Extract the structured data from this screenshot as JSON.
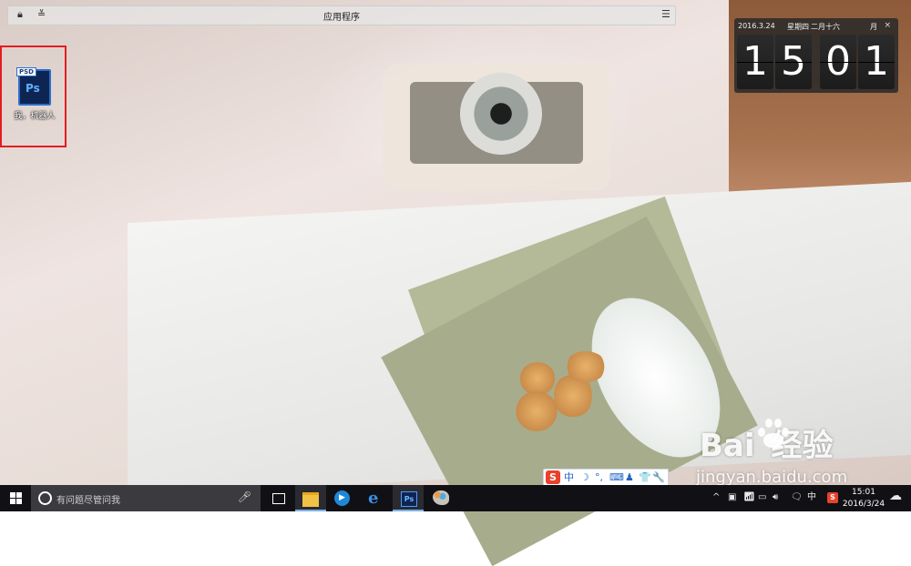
{
  "app_bar": {
    "title": "应用程序",
    "lock_icon": "lock-icon",
    "collapse_icon": "double-chevron-down-icon",
    "menu_icon": "menu-icon"
  },
  "desktop": {
    "icon": {
      "file_tag": "PSD",
      "app_badge": "Ps",
      "label": "我，机器人"
    }
  },
  "clock_widget": {
    "date": "2016.3.24",
    "weekday": "星期四",
    "lunar": "二月十六",
    "mode": "月",
    "close": "×",
    "digits": [
      "1",
      "5",
      "0",
      "1"
    ]
  },
  "ime_bar": {
    "brand": "S",
    "lang": "中",
    "items": [
      "☽",
      "°,",
      "⌨",
      "♟",
      "👕",
      "🔧"
    ]
  },
  "watermark": {
    "brand_a": "Bai",
    "brand_b": "经验",
    "url": "jingyan.baidu.com"
  },
  "taskbar": {
    "search_placeholder": "有问题尽管问我",
    "mic_icon": "microphone-icon",
    "apps": [
      "task-view",
      "file-explorer",
      "media-player",
      "edge",
      "photoshop",
      "paint"
    ],
    "ps_label": "Ps",
    "media_label": "▶",
    "edge_label": "e",
    "tray": {
      "chevron": "^",
      "lang": "中",
      "ime_brand": "S",
      "time": "15:01",
      "date": "2016/3/24"
    }
  },
  "colors": {
    "highlight_box": "#e21d23",
    "taskbar_bg": "#101015",
    "accent": "#7cb0e8"
  }
}
